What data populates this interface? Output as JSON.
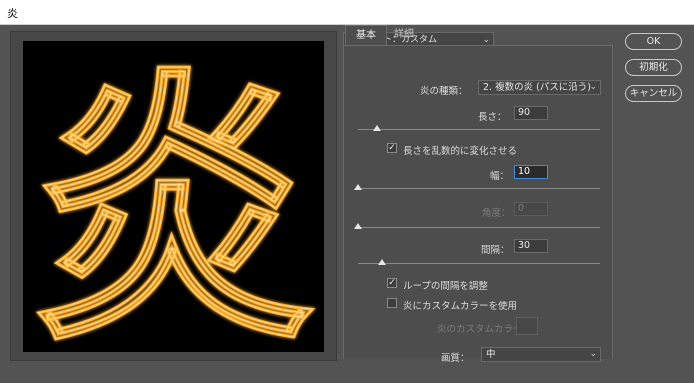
{
  "window": {
    "title": "炎"
  },
  "preview": {
    "glyph": "炎",
    "flame_color": "#ffae2e"
  },
  "preset": {
    "label": "プリセット：カスタム"
  },
  "tabs": [
    {
      "label": "基本",
      "active": true
    },
    {
      "label": "詳細",
      "active": false
    }
  ],
  "form": {
    "flame_type": {
      "label": "炎の種類：",
      "value": "2. 複数の炎 (パスに沿う)"
    },
    "length": {
      "label": "長さ：",
      "value": "90",
      "slider": 0.08
    },
    "randomize_length": {
      "label": "長さを乱数的に変化させる",
      "checked": true
    },
    "width": {
      "label": "幅：",
      "value": "10",
      "slider": 0.0
    },
    "angle": {
      "label": "角度：",
      "value": "0",
      "slider": 0.0,
      "disabled": true
    },
    "interval": {
      "label": "間隔：",
      "value": "30",
      "slider": 0.1
    },
    "adjust_loop": {
      "label": "ループの間隔を調整",
      "checked": true
    },
    "custom_color": {
      "label": "炎にカスタムカラーを使用",
      "checked": false
    },
    "custom_color_swatch": {
      "label": "炎のカスタムカラー：",
      "disabled": true
    },
    "quality": {
      "label": "画質：",
      "value": "中"
    }
  },
  "buttons": {
    "ok": "OK",
    "reset": "初期化",
    "cancel": "キャンセル"
  },
  "icons": {
    "dropdown": "chevron-down-icon",
    "check": "checkmark-icon"
  }
}
